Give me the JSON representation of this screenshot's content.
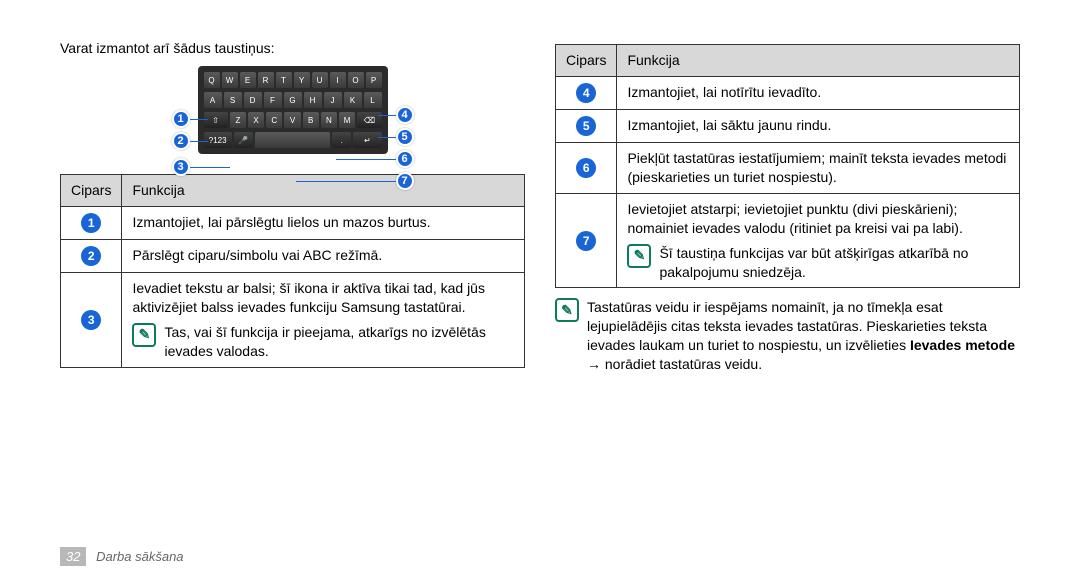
{
  "intro": "Varat izmantot arī šādus taustiņus:",
  "keyboard": {
    "callouts_left": [
      "1",
      "2",
      "3"
    ],
    "callouts_right": [
      "4",
      "5",
      "6",
      "7"
    ]
  },
  "left_table": {
    "headers": [
      "Cipars",
      "Funkcija"
    ],
    "rows": [
      {
        "num": "1",
        "text": "Izmantojiet, lai pārslēgtu lielos un mazos burtus."
      },
      {
        "num": "2",
        "text": "Pārslēgt ciparu/simbolu vai ABC režīmā."
      },
      {
        "num": "3",
        "text": "Ievadiet tekstu ar balsi; šī ikona ir aktīva tikai tad, kad jūs aktivizējiet balss ievades funkciju Samsung tastatūrai.",
        "note": "Tas, vai šī funkcija ir pieejama, atkarīgs no izvēlētās ievades valodas."
      }
    ]
  },
  "right_table": {
    "headers": [
      "Cipars",
      "Funkcija"
    ],
    "rows": [
      {
        "num": "4",
        "text": "Izmantojiet, lai notīrītu ievadīto."
      },
      {
        "num": "5",
        "text": "Izmantojiet, lai sāktu jaunu rindu."
      },
      {
        "num": "6",
        "text": "Piekļūt tastatūras iestatījumiem; mainīt teksta ievades metodi (pieskarieties un turiet nospiestu)."
      },
      {
        "num": "7",
        "text": "Ievietojiet atstarpi; ievietojiet punktu (divi pieskārieni); nomainiet ievades valodu (ritiniet pa kreisi vai pa labi).",
        "note": "Šī taustiņa funkcijas var būt atšķirīgas atkarībā no pakalpojumu sniedzēja."
      }
    ]
  },
  "bottom_note_pre": "Tastatūras veidu ir iespējams nomainīt, ja no tīmekļa esat lejupielādējis citas teksta ievades tastatūras. Pieskarieties teksta ievades laukam un turiet to nospiestu, un izvēlieties ",
  "bottom_note_strong": "Ievades metode",
  "bottom_note_post": " → norādiet tastatūras veidu.",
  "footer": {
    "page": "32",
    "section": "Darba sākšana"
  }
}
